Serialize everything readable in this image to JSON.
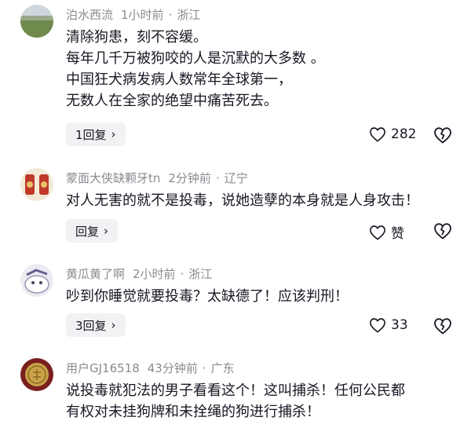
{
  "comments": [
    {
      "username": "泊水西流",
      "time": "1小时前",
      "location": "浙江",
      "lines": [
        "清除狗患，刻不容缓。",
        "每年几千万被狗咬的人是沉默的大多数 。",
        "中国狂犬病发病人数常年全球第一，",
        "无数人在全家的绝望中痛苦死去。"
      ],
      "reply_label": "1回复",
      "like_count": "282"
    },
    {
      "username": "蒙面大侠缺颗牙tn",
      "time": "2分钟前",
      "location": "辽宁",
      "lines": [
        "对人无害的就不是投毒，说她造孽的本身就是人身攻击！"
      ],
      "reply_label": "回复",
      "like_count": "赞"
    },
    {
      "username": "黄瓜黄了啊",
      "time": "2小时前",
      "location": "浙江",
      "lines": [
        "吵到你睡觉就要投毒？太缺德了！应该判刑！"
      ],
      "reply_label": "3回复",
      "like_count": "33"
    },
    {
      "username": "用户GJ16518",
      "time": "43分钟前",
      "location": "广东",
      "lines": [
        "说投毒就犯法的男子看看这个！这叫捕杀！任何公民都",
        "有权对未挂狗牌和未拴绳的狗进行捕杀！"
      ]
    }
  ],
  "separator": "·",
  "icons": {
    "like": "heart-outline-icon",
    "dislike": "broken-heart-icon",
    "chevron": "chevron-right-icon"
  }
}
